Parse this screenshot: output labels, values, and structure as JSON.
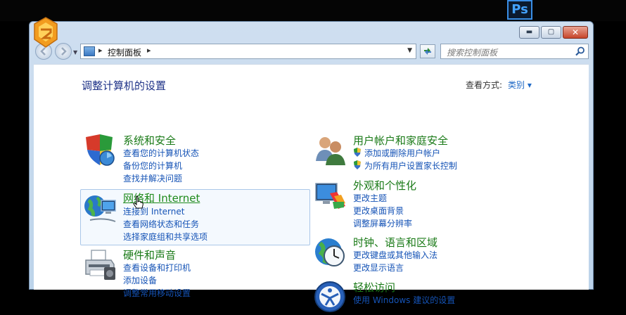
{
  "taskbar": {
    "ps_label": "Ps"
  },
  "window": {
    "controls": {
      "minimize": "▬",
      "maximize": "▢",
      "close": "✕"
    }
  },
  "address": {
    "breadcrumb": "控制面板",
    "search_placeholder": "搜索控制面板"
  },
  "page": {
    "title": "调整计算机的设置",
    "view_by_label": "查看方式:",
    "view_by_value": "类别 ▾"
  },
  "categories": [
    {
      "id": "system-security",
      "title": "系统和安全",
      "icon": "shield-icon",
      "links": [
        "查看您的计算机状态",
        "备份您的计算机",
        "查找并解决问题"
      ]
    },
    {
      "id": "network-internet",
      "title": "网络和 Internet",
      "icon": "network-globe-icon",
      "links": [
        "连接到 Internet",
        "查看网络状态和任务",
        "选择家庭组和共享选项"
      ]
    },
    {
      "id": "hardware-sound",
      "title": "硬件和声音",
      "icon": "printer-icon",
      "links": [
        "查看设备和打印机",
        "添加设备",
        "调整常用移动设置"
      ]
    },
    {
      "id": "user-accounts",
      "title": "用户帐户和家庭安全",
      "icon": "users-icon",
      "links": [
        "添加或删除用户帐户",
        "为所有用户设置家长控制"
      ]
    },
    {
      "id": "appearance",
      "title": "外观和个性化",
      "icon": "appearance-icon",
      "links": [
        "更改主题",
        "更改桌面背景",
        "调整屏幕分辨率"
      ]
    },
    {
      "id": "clock-region",
      "title": "时钟、语言和区域",
      "icon": "clock-globe-icon",
      "links": [
        "更改键盘或其他输入法",
        "更改显示语言"
      ]
    },
    {
      "id": "ease-of-access",
      "title": "轻松访问",
      "icon": "ease-of-access-icon",
      "links": [
        "使用 Windows 建议的设置"
      ]
    }
  ]
}
